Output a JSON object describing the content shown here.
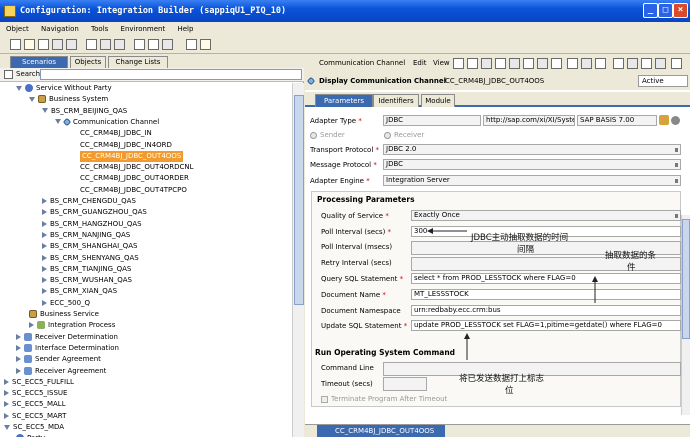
{
  "window": {
    "title": "Configuration: Integration Builder (sappiqU1_PIQ_10)"
  },
  "menu": [
    "Object",
    "Navigation",
    "Tools",
    "Environment",
    "Help"
  ],
  "left": {
    "tabs": [
      "Scenarios",
      "Objects",
      "Change Lists"
    ],
    "search_label": "Search:",
    "tree": [
      {
        "label": "Service Without Party",
        "level": 0,
        "exp": "d",
        "icon": "sw"
      },
      {
        "label": "Business System",
        "level": 1,
        "exp": "d",
        "icon": "bs"
      },
      {
        "label": "BS_CRM_BEIJING_QAS",
        "level": 2,
        "exp": "d",
        "icon": ""
      },
      {
        "label": "Communication Channel",
        "level": 3,
        "exp": "d",
        "icon": "ch"
      },
      {
        "label": "CC_CRM4BJ_JDBC_IN",
        "level": 4,
        "exp": "",
        "icon": ""
      },
      {
        "label": "CC_CRM4BJ_JDBC_IN4ORD",
        "level": 4,
        "exp": "",
        "icon": ""
      },
      {
        "label": "CC_CRM4BJ_JDBC_OUT4OOS",
        "level": 4,
        "exp": "",
        "icon": "",
        "selected": true
      },
      {
        "label": "CC_CRM4BJ_JDBC_OUT4ORDCNL",
        "level": 4,
        "exp": "",
        "icon": ""
      },
      {
        "label": "CC_CRM4BJ_JDBC_OUT4ORDER",
        "level": 4,
        "exp": "",
        "icon": ""
      },
      {
        "label": "CC_CRM4BJ_JDBC_OUT4TPCPO",
        "level": 4,
        "exp": "",
        "icon": ""
      },
      {
        "label": "BS_CRM_CHENGDU_QAS",
        "level": 2,
        "exp": "r",
        "icon": ""
      },
      {
        "label": "BS_CRM_GUANGZHOU_QAS",
        "level": 2,
        "exp": "r",
        "icon": ""
      },
      {
        "label": "BS_CRM_HANGZHOU_QAS",
        "level": 2,
        "exp": "r",
        "icon": ""
      },
      {
        "label": "BS_CRM_NANJING_QAS",
        "level": 2,
        "exp": "r",
        "icon": ""
      },
      {
        "label": "BS_CRM_SHANGHAI_QAS",
        "level": 2,
        "exp": "r",
        "icon": ""
      },
      {
        "label": "BS_CRM_SHENYANG_QAS",
        "level": 2,
        "exp": "r",
        "icon": ""
      },
      {
        "label": "BS_CRM_TIANJING_QAS",
        "level": 2,
        "exp": "r",
        "icon": ""
      },
      {
        "label": "BS_CRM_WUSHAN_QAS",
        "level": 2,
        "exp": "r",
        "icon": ""
      },
      {
        "label": "BS_CRM_XIAN_QAS",
        "level": 2,
        "exp": "r",
        "icon": ""
      },
      {
        "label": "ECC_500_Q",
        "level": 2,
        "exp": "r",
        "icon": ""
      },
      {
        "label": "Business Service",
        "level": 1,
        "exp": "",
        "icon": "bs"
      },
      {
        "label": "Integration Process",
        "level": 1,
        "exp": "r",
        "icon": "ip"
      },
      {
        "label": "Receiver Determination",
        "level": 0,
        "exp": "r",
        "icon": "rd"
      },
      {
        "label": "Interface Determination",
        "level": 0,
        "exp": "r",
        "icon": "rd"
      },
      {
        "label": "Sender Agreement",
        "level": 0,
        "exp": "r",
        "icon": "rd"
      },
      {
        "label": "Receiver Agreement",
        "level": 0,
        "exp": "r",
        "icon": "rd"
      },
      {
        "label": "SC_ECC5_FULFILL",
        "level": -1,
        "exp": "r",
        "icon": ""
      },
      {
        "label": "SC_ECC5_ISSUE",
        "level": -1,
        "exp": "r",
        "icon": ""
      },
      {
        "label": "SC_ECC5_MALL",
        "level": -1,
        "exp": "r",
        "icon": ""
      },
      {
        "label": "SC_ECC5_MART",
        "level": -1,
        "exp": "r",
        "icon": ""
      },
      {
        "label": "SC_ECC5_MDA",
        "level": -1,
        "exp": "d",
        "icon": ""
      },
      {
        "label": "Party",
        "level": 0,
        "exp": "",
        "icon": "sw"
      }
    ]
  },
  "right": {
    "toolbar_menu": [
      "Communication Channel",
      "Edit",
      "View"
    ],
    "header_title": "Display Communication Channel",
    "header_object": "CC_CRM4BJ_JDBC_OUT4OOS",
    "status": "Active",
    "tabs": [
      "Parameters",
      "Identifiers",
      "Module"
    ],
    "adapter_type_label": "Adapter Type",
    "adapter_type": "JDBC",
    "adapter_ns": "http://sap.com/xi/XI/System",
    "adapter_swc": "SAP BASIS 7.00",
    "sender": "Sender",
    "receiver": "Receiver",
    "transport_label": "Transport Protocol",
    "transport": "JDBC 2.0",
    "message_label": "Message Protocol",
    "message": "JDBC",
    "engine_label": "Adapter Engine",
    "engine": "Integration Server",
    "proc_title": "Processing Parameters",
    "qos_label": "Quality of Service",
    "qos": "Exactly Once",
    "poll_label": "Poll Interval (secs)",
    "poll": "300",
    "pollms_label": "Poll Interval (msecs)",
    "retry_label": "Retry Interval (secs)",
    "query_label": "Query SQL Statement",
    "query": "select * from PROD_LESSTOCK where FLAG=0",
    "docname_label": "Document Name",
    "docname": "MT_LESSSTOCK",
    "docns_label": "Document Namespace",
    "docns": "urn:redbaby.ecc.crm:bus",
    "update_label": "Update SQL Statement",
    "update": "update PROD_LESSTOCK set FLAG=1,pitime=getdate()  where FLAG=0",
    "os_title": "Run Operating System Command",
    "cmd_label": "Command Line",
    "timeout_label": "Timeout (secs)",
    "terminate_label": "Terminate Program After Timeout",
    "bottom_tab": "CC_CRM4BJ_JDBC_OUT4OOS"
  },
  "annotations": {
    "a1": "JDBC主动抽取数据的时间",
    "a1b": "间隔",
    "a2": "抽取数据的条",
    "a2b": "件",
    "a3": "将已发送数据打上标志",
    "a3b": "位"
  }
}
